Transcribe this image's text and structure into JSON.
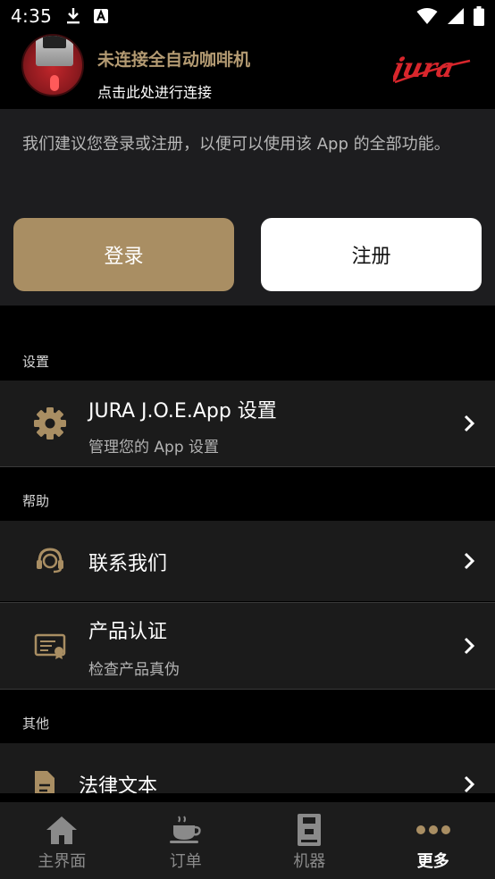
{
  "status_bar": {
    "time": "4:35",
    "icons": [
      "download-icon",
      "a-notification-icon",
      "wifi-icon",
      "signal-icon",
      "battery-icon"
    ]
  },
  "header": {
    "title": "未连接全自动咖啡机",
    "subtitle": "点击此处进行连接",
    "logo_text": "jura"
  },
  "login_card": {
    "message": "我们建议您登录或注册，以便可以使用该 App 的全部功能。",
    "login_label": "登录",
    "register_label": "注册"
  },
  "sections": {
    "settings": {
      "label": "设置",
      "item_title": "JURA J.O.E.App 设置",
      "item_subtitle": "管理您的 App 设置"
    },
    "help": {
      "label": "帮助",
      "contact_title": "联系我们",
      "cert_title": "产品认证",
      "cert_subtitle": "检查产品真伪"
    },
    "other": {
      "label": "其他",
      "legal_title": "法律文本"
    }
  },
  "bottom_nav": {
    "items": [
      {
        "label": "主界面",
        "icon": "home-icon",
        "active": false
      },
      {
        "label": "订单",
        "icon": "coffee-cup-icon",
        "active": false
      },
      {
        "label": "机器",
        "icon": "coffee-machine-icon",
        "active": false
      },
      {
        "label": "更多",
        "icon": "more-dots-icon",
        "active": true
      }
    ]
  },
  "colors": {
    "accent": "#A98E63",
    "brand_red": "#D8262C",
    "background": "#000000",
    "card": "#1B1B1B"
  }
}
